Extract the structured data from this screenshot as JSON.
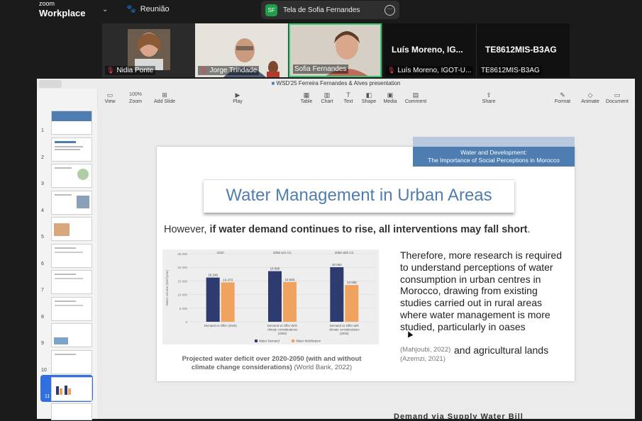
{
  "app": {
    "brand_small": "zoom",
    "brand_big": "Workplace",
    "meeting_label": "Reunião"
  },
  "share_pill": {
    "initials": "SF",
    "title": "Tela de Sofia Fernandes"
  },
  "participants": [
    {
      "name": "Nidia Ponte"
    },
    {
      "name": "Jorge Trindade"
    },
    {
      "name": "Sofia Fernandes"
    },
    {
      "name": "Luís Moreno, IGOT-U...",
      "big_label": "Luís Moreno, IG..."
    },
    {
      "name": "TE8612MIS-B3AG",
      "big_label": "TE8612MIS-B3AG"
    }
  ],
  "keynote": {
    "doc_title": "WSD'25 Ferreira Fernandes & Alves presentation",
    "toolbar": {
      "view": "View",
      "zoom_value": "100%",
      "zoom": "Zoom",
      "add_slide": "Add Slide",
      "play": "Play",
      "table": "Table",
      "chart": "Chart",
      "text": "Text",
      "shape": "Shape",
      "media": "Media",
      "comment": "Comment",
      "share": "Share",
      "format": "Format",
      "animate": "Animate",
      "document": "Document"
    },
    "slide_numbers": [
      "1",
      "2",
      "3",
      "4",
      "5",
      "6",
      "7",
      "8",
      "9",
      "10",
      "11"
    ],
    "selected_slide": "11"
  },
  "slide": {
    "tag_line1": "Water and Development:",
    "tag_line2": "The Importance of Social Perceptions in Morocco",
    "title": "Water Management in Urban Areas",
    "subtitle_lead": "However, ",
    "subtitle_bold": "if water demand continues to rise, all interventions may fall short",
    "subtitle_end": ".",
    "paragraph": "Therefore, more research is required to understand perceptions of water consumption in urban centres in Morocco, drawing from existing studies carried out in rural areas where water management is more studied, particularly in oases",
    "cite1": "(Mahjoubi, 2022)",
    "cite_inline": "and agricultural lands",
    "cite2": "(Azemzi, 2021)",
    "caption_bold": "Projected water deficit over 2020-2050 (with and without climate change considerations)",
    "caption_tail": " (World Bank, 2022)",
    "bottom_text": "Demand via Supply Water Bill"
  },
  "chart_data": {
    "type": "bar",
    "panel_titles": [
      "2020",
      "2050 w/o CC",
      "2050 with CC"
    ],
    "categories": [
      "Demand vs Offer (2020)",
      "Demand vs Offer W/O climate considerations (2050)",
      "Demand vs Offer with climate considerations (2050)"
    ],
    "series": [
      {
        "name": "Water Demand",
        "values": [
          16249,
          18606,
          20064
        ],
        "color": "#2e3b6e"
      },
      {
        "name": "Water Mobilization",
        "values": [
          14473,
          14624,
          13535
        ],
        "color": "#f0a35e"
      }
    ],
    "value_labels": [
      [
        "16 249",
        "14 473"
      ],
      [
        "18 606",
        "14 624"
      ],
      [
        "20 064",
        "13 535"
      ]
    ],
    "ylabel": "Water volume (Mm³/year)",
    "yticks": [
      "0",
      "5 000",
      "10 000",
      "15 000",
      "20 000",
      "25 000"
    ],
    "ylim": [
      0,
      25000
    ],
    "grid": true,
    "legend": "bottom"
  }
}
